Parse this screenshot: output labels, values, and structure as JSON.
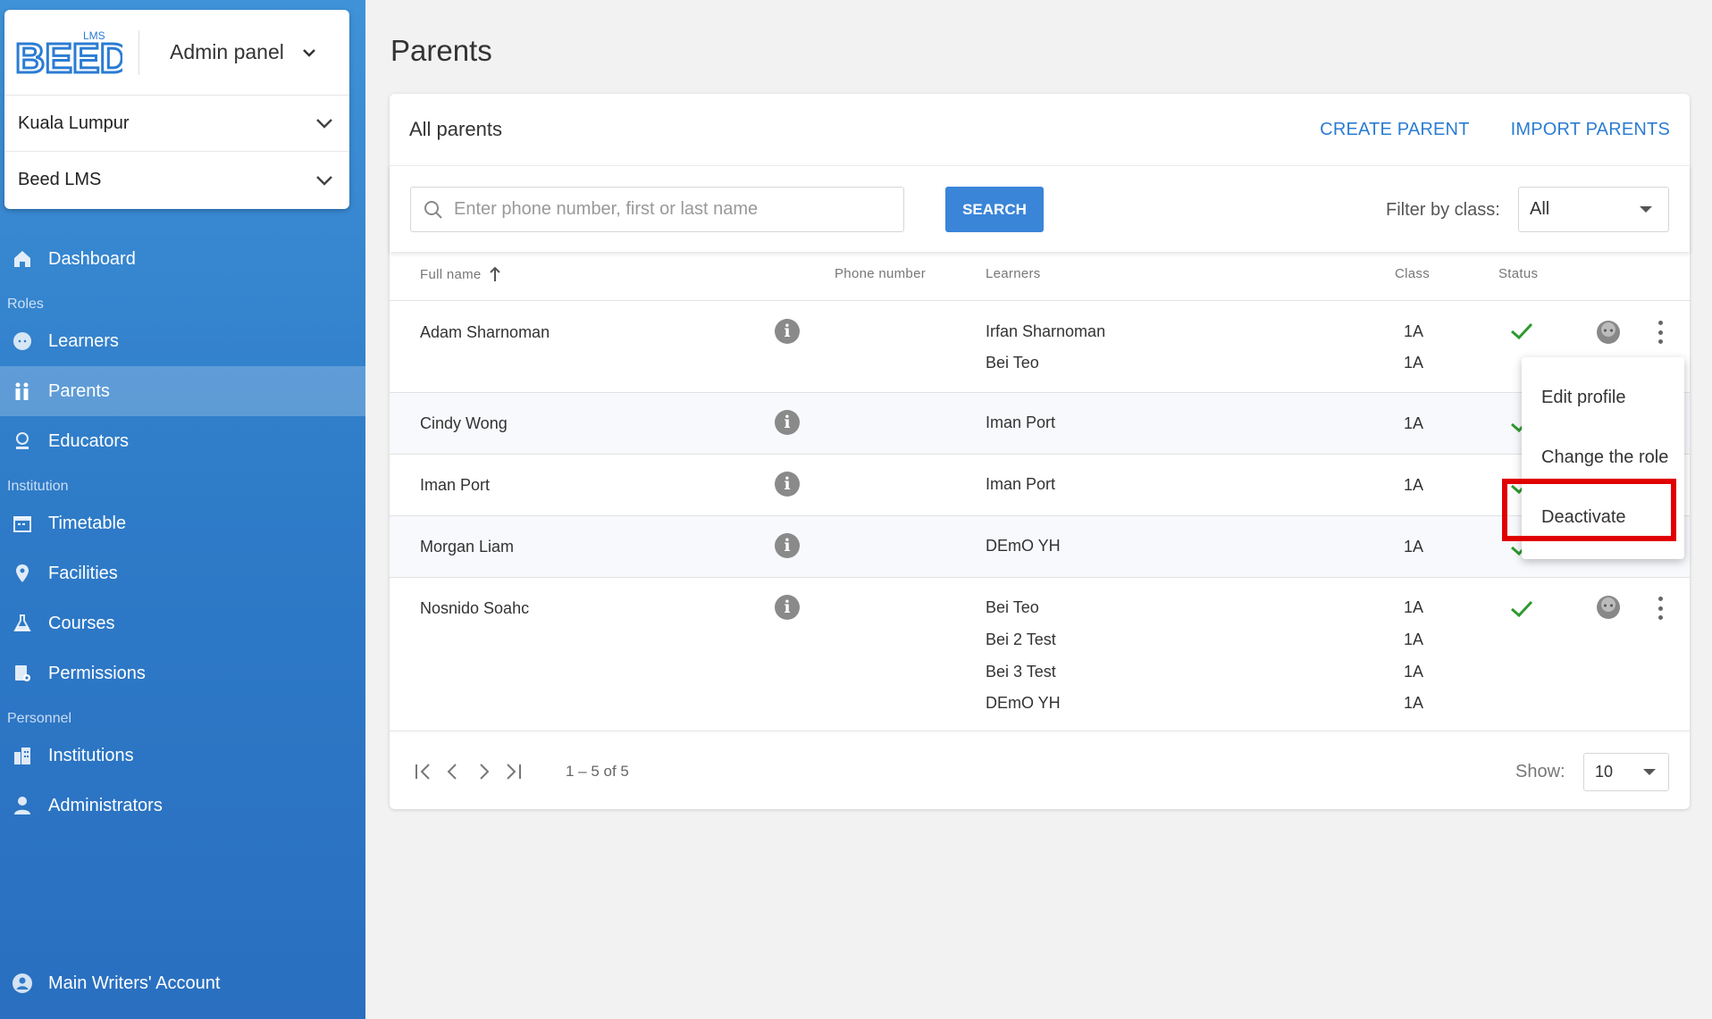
{
  "sidebar": {
    "logo_text": "BEED",
    "logo_sub": "LMS",
    "panel_label": "Admin panel",
    "location_select": "Kuala Lumpur",
    "org_select": "Beed LMS",
    "dashboard": "Dashboard",
    "sections": {
      "roles": "Roles",
      "institution": "Institution",
      "personnel": "Personnel"
    },
    "roles_items": [
      "Learners",
      "Parents",
      "Educators"
    ],
    "institution_items": [
      "Timetable",
      "Facilities",
      "Courses",
      "Permissions"
    ],
    "personnel_items": [
      "Institutions",
      "Administrators"
    ],
    "account": "Main Writers' Account",
    "active_item": "Parents"
  },
  "page": {
    "title": "Parents"
  },
  "card": {
    "title": "All parents",
    "create_link": "CREATE PARENT",
    "import_link": "IMPORT PARENTS"
  },
  "search": {
    "placeholder": "Enter phone number, first or last name",
    "button": "SEARCH",
    "filter_label": "Filter by class:",
    "filter_value": "All"
  },
  "table": {
    "headers": {
      "full_name": "Full name",
      "phone": "Phone number",
      "learners": "Learners",
      "class": "Class",
      "status": "Status"
    },
    "rows": [
      {
        "name": "Adam Sharnoman",
        "learners": [
          "Irfan Sharnoman",
          "Bei Teo"
        ],
        "classes": [
          "1A",
          "1A"
        ]
      },
      {
        "name": "Cindy Wong",
        "learners": [
          "Iman Port"
        ],
        "classes": [
          "1A"
        ]
      },
      {
        "name": "Iman Port",
        "learners": [
          "Iman Port"
        ],
        "classes": [
          "1A"
        ]
      },
      {
        "name": "Morgan Liam",
        "learners": [
          "DEmO YH"
        ],
        "classes": [
          "1A"
        ]
      },
      {
        "name": "Nosnido Soahc",
        "learners": [
          "Bei Teo",
          "Bei 2 Test",
          "Bei 3 Test",
          "DEmO YH"
        ],
        "classes": [
          "1A",
          "1A",
          "1A",
          "1A"
        ]
      }
    ]
  },
  "context_menu": {
    "items": [
      "Edit profile",
      "Change the role",
      "Deactivate"
    ],
    "highlighted": "Deactivate"
  },
  "pagination": {
    "range": "1 – 5 of 5",
    "show_label": "Show:",
    "page_size": "10"
  },
  "colors": {
    "accent": "#2b7cd3",
    "status_ok": "#2e9a2e",
    "highlight": "#e00000"
  }
}
